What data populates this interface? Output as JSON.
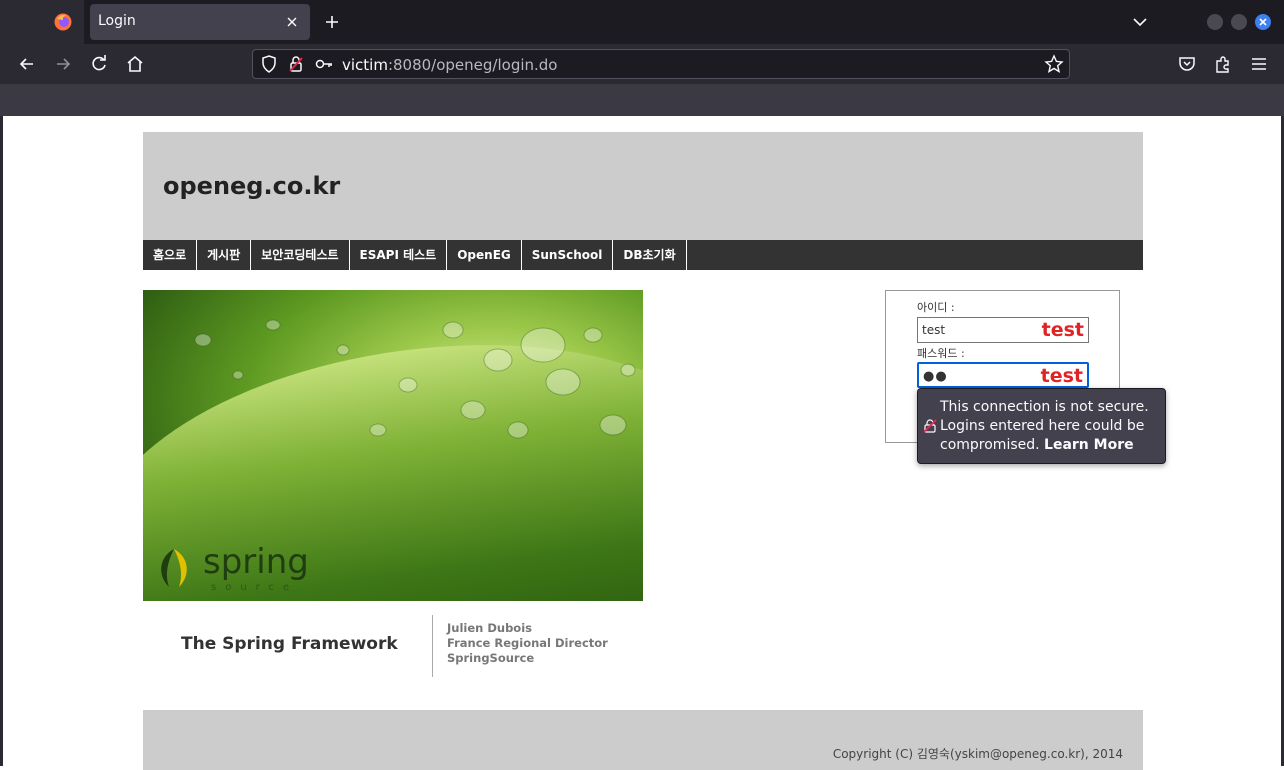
{
  "browser": {
    "tab_title": "Login",
    "url_host": "victim",
    "url_rest": ":8080/openeg/login.do"
  },
  "site": {
    "title": "openeg.co.kr",
    "menu": [
      "홈으로",
      "게시판",
      "보안코딩테스트",
      "ESAPI 테스트",
      "OpenEG",
      "SunSchool",
      "DB초기화"
    ]
  },
  "banner": {
    "logo_word": "spring",
    "logo_sub": "source",
    "framework_title": "The Spring Framework",
    "author_lines": [
      "Julien Dubois",
      "France Regional Director",
      "SpringSource"
    ]
  },
  "login": {
    "id_label": "아이디 :",
    "id_value": "test",
    "id_autofill_mark": "test",
    "pw_label": "패스워드 :",
    "pw_value": "●●",
    "pw_autofill_mark": "test"
  },
  "insecure_popup": {
    "message": "This connection is not secure. Logins entered here could be compromised.",
    "link": "Learn More"
  },
  "footer": {
    "copyright": "Copyright (C) 김영숙(yskim@openeg.co.kr), 2014"
  },
  "colors": {
    "chrome_dark": "#1c1b22",
    "chrome_toolbar": "#2b2a33",
    "header_gray": "#cccccc",
    "menu_dark": "#333333",
    "autofill_red": "#e02424",
    "focus_blue": "#0060df"
  },
  "icons": [
    "firefox-icon",
    "close-icon",
    "plus-icon",
    "chevron-down-icon",
    "back-icon",
    "forward-icon",
    "reload-icon",
    "home-icon",
    "shield-icon",
    "insecure-lock-icon",
    "key-icon",
    "star-icon",
    "pocket-icon",
    "extensions-icon",
    "menu-icon"
  ]
}
